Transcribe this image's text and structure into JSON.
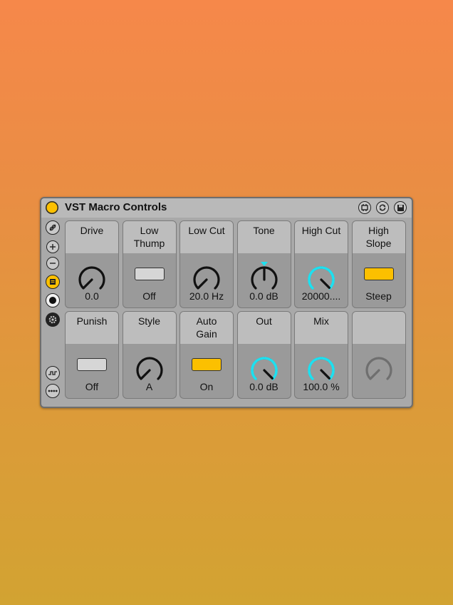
{
  "device": {
    "title": "VST Macro Controls",
    "power_color": "#fcc000",
    "header_icons": [
      "hotswap-icon",
      "refresh-icon",
      "save-icon"
    ]
  },
  "sidebar": {
    "icons": [
      "link-icon",
      "add-icon",
      "remove-icon",
      "list-icon",
      "record-icon",
      "settings-icon",
      "waveform-icon",
      "more-icon"
    ],
    "active_color": "#fcc000"
  },
  "controls": [
    {
      "label": "Drive",
      "type": "knob",
      "value": "0.0",
      "level": 0.0,
      "accent": "#111111"
    },
    {
      "label": "Low\nThump",
      "type": "toggle",
      "value": "Off",
      "state": "off"
    },
    {
      "label": "Low Cut",
      "type": "knob",
      "value": "20.0  Hz",
      "level": 0.0,
      "accent": "#111111"
    },
    {
      "label": "Tone",
      "type": "knob",
      "value": "0.0  dB",
      "level": 0.5,
      "accent": "#111111",
      "bipolar": true
    },
    {
      "label": "High Cut",
      "type": "knob",
      "value": "20000....",
      "level": 1.0,
      "accent": "#1ee0f0"
    },
    {
      "label": "High\nSlope",
      "type": "toggle",
      "value": "Steep",
      "state": "on"
    },
    {
      "label": "Punish",
      "type": "toggle",
      "value": "Off",
      "state": "off"
    },
    {
      "label": "Style",
      "type": "knob",
      "value": "A",
      "level": 0.0,
      "accent": "#111111"
    },
    {
      "label": "Auto\nGain",
      "type": "toggle",
      "value": "On",
      "state": "on"
    },
    {
      "label": "Out",
      "type": "knob",
      "value": "0.0  dB",
      "level": 1.0,
      "accent": "#1ee0f0"
    },
    {
      "label": "Mix",
      "type": "knob",
      "value": "100.0  %",
      "level": 1.0,
      "accent": "#1ee0f0"
    },
    {
      "label": "",
      "type": "knob",
      "value": "",
      "level": 0.0,
      "accent": "#6f6f6f",
      "disabled": true
    }
  ],
  "colors": {
    "toggle_on": "#fcc000",
    "toggle_off": "#d6d6d6",
    "knob_track": "#111111",
    "knob_active": "#1ee0f0"
  }
}
